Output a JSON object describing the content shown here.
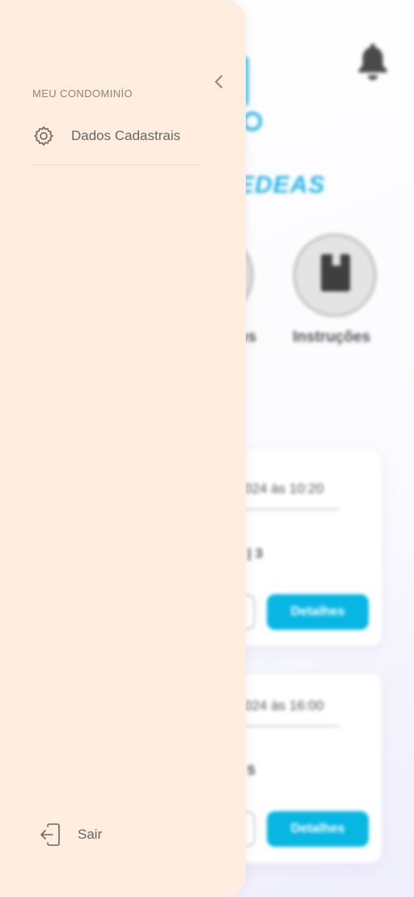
{
  "drawer": {
    "section_title": "MEU CONDOMINÍO",
    "items": [
      {
        "label": "Dados Cadastrais",
        "icon": "gear-icon"
      }
    ],
    "logout_label": "Sair",
    "background": "#ffede0"
  },
  "background_app": {
    "brand_text": "EDEAS",
    "shortcuts": [
      {
        "label": "es"
      },
      {
        "label": "Instruções"
      }
    ],
    "cards": [
      {
        "date": "024 às 10:20",
        "code": "| 3",
        "button_label": "Detalhes"
      },
      {
        "date": "024 às 16:00",
        "code": "5",
        "button_label": "Detalhes"
      }
    ],
    "accent_color": "#08b6e3"
  }
}
